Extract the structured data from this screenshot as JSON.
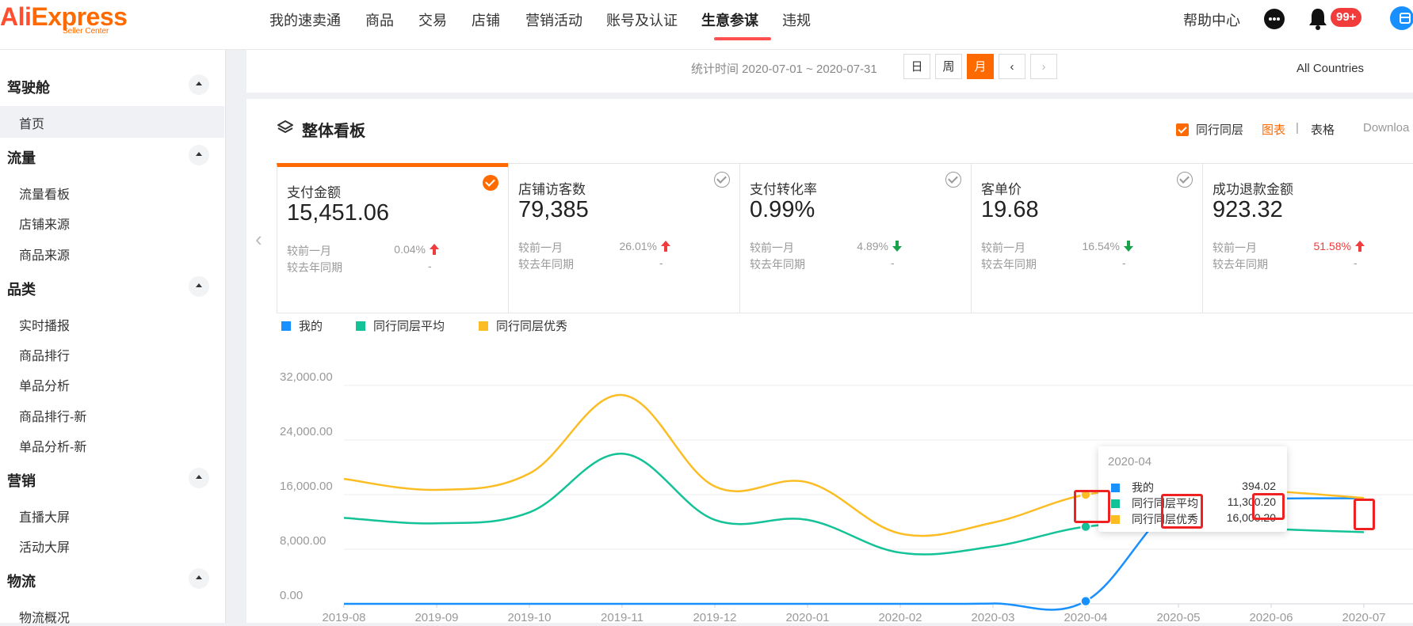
{
  "brand": {
    "logo_text_a": "Ali",
    "logo_text_b": "Express",
    "logo_sub": "Seller Center"
  },
  "top_nav": {
    "items": [
      "我的速卖通",
      "商品",
      "交易",
      "店铺",
      "营销活动",
      "账号及认证",
      "生意参谋",
      "违规"
    ],
    "active": "生意参谋",
    "help": "帮助中心",
    "notification_badge": "99+"
  },
  "sidebar": {
    "groups": [
      {
        "title": "驾驶舱",
        "items": [
          "首页"
        ]
      },
      {
        "title": "流量",
        "items": [
          "流量看板",
          "店铺来源",
          "商品来源"
        ]
      },
      {
        "title": "品类",
        "items": [
          "实时播报",
          "商品排行",
          "单品分析",
          "商品排行-新",
          "单品分析-新"
        ]
      },
      {
        "title": "营销",
        "items": [
          "直播大屏",
          "活动大屏"
        ]
      },
      {
        "title": "物流",
        "items": [
          "物流概况"
        ]
      }
    ],
    "active_item": "首页"
  },
  "filter": {
    "period_label": "统计时间 2020-07-01 ~ 2020-07-31",
    "buttons": [
      "日",
      "周",
      "月"
    ],
    "active_button": "月",
    "prev": "‹",
    "next": "›",
    "country": "All Countries"
  },
  "dashboard": {
    "title": "整体看板",
    "peer_checkbox": "同行同层",
    "view_chart": "图表",
    "separator": "|",
    "view_table": "表格",
    "download": "Downloa",
    "accent": "#ff6a00"
  },
  "kpis": [
    {
      "name": "支付金额",
      "value": "15,451.06",
      "mom_label": "较前一月",
      "mom": "0.04%",
      "mom_dir": "up",
      "yoy_label": "较去年同期",
      "yoy": "-",
      "selected": true
    },
    {
      "name": "店铺访客数",
      "value": "79,385",
      "mom_label": "较前一月",
      "mom": "26.01%",
      "mom_dir": "up",
      "yoy_label": "较去年同期",
      "yoy": "-",
      "selected": false
    },
    {
      "name": "支付转化率",
      "value": "0.99%",
      "mom_label": "较前一月",
      "mom": "4.89%",
      "mom_dir": "down",
      "yoy_label": "较去年同期",
      "yoy": "-",
      "selected": false
    },
    {
      "name": "客单价",
      "value": "19.68",
      "mom_label": "较前一月",
      "mom": "16.54%",
      "mom_dir": "down",
      "yoy_label": "较去年同期",
      "yoy": "-",
      "selected": false
    },
    {
      "name": "成功退款金额",
      "value": "923.32",
      "mom_label": "较前一月",
      "mom": "51.58%",
      "mom_dir": "up",
      "yoy_label": "较去年同期",
      "yoy": "-",
      "selected": false,
      "mom_highlight": true
    }
  ],
  "chart_data": {
    "type": "line",
    "x": [
      "2019-08",
      "2019-09",
      "2019-10",
      "2019-11",
      "2019-12",
      "2020-01",
      "2020-02",
      "2020-03",
      "2020-04",
      "2020-05",
      "2020-06",
      "2020-07"
    ],
    "series": [
      {
        "name": "我的",
        "color": "#1890ff",
        "values": [
          0,
          0,
          0,
          0,
          0,
          0,
          0,
          50,
          394.02,
          14800,
          15400,
          15451.06
        ]
      },
      {
        "name": "同行同层平均",
        "color": "#13c296",
        "values": [
          12600,
          11800,
          13400,
          22000,
          12300,
          12300,
          7500,
          8400,
          11300.2,
          11900,
          11000,
          10500
        ]
      },
      {
        "name": "同行同层优秀",
        "color": "#fbbd23",
        "values": [
          18300,
          16700,
          19100,
          30600,
          17200,
          17800,
          10300,
          11900,
          16000,
          16800,
          16500,
          15500
        ]
      }
    ],
    "y_ticks": [
      "0.00",
      "8,000.00",
      "16,000.00",
      "24,000.00",
      "32,000.00"
    ],
    "ylim": [
      0,
      32000
    ],
    "grid": true,
    "legend": "top-left",
    "tooltip": {
      "title": "2020-04",
      "rows": [
        {
          "name": "我的",
          "value": "394.02",
          "color": "#1890ff"
        },
        {
          "name": "同行同层平均",
          "value": "11,300.20",
          "color": "#13c296"
        },
        {
          "name": "同行同层优秀",
          "value": "16,000.20",
          "color": "#fbbd23"
        }
      ]
    }
  }
}
